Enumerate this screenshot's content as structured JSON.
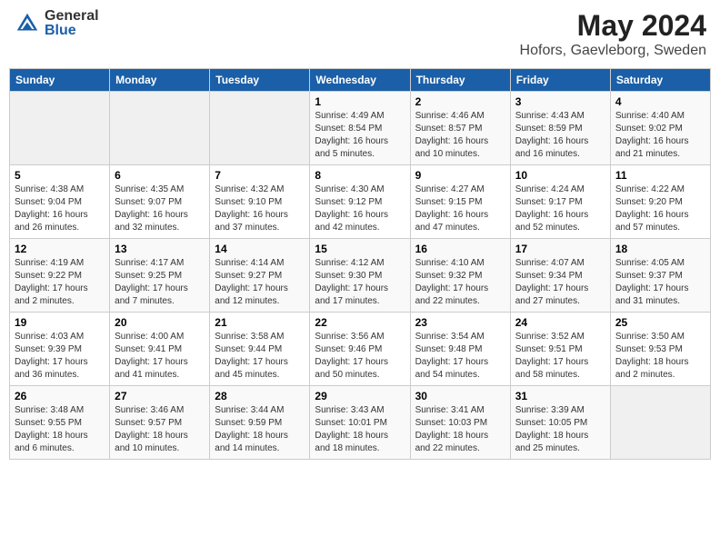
{
  "header": {
    "logo_general": "General",
    "logo_blue": "Blue",
    "month": "May 2024",
    "location": "Hofors, Gaevleborg, Sweden"
  },
  "weekdays": [
    "Sunday",
    "Monday",
    "Tuesday",
    "Wednesday",
    "Thursday",
    "Friday",
    "Saturday"
  ],
  "weeks": [
    [
      {
        "day": "",
        "info": ""
      },
      {
        "day": "",
        "info": ""
      },
      {
        "day": "",
        "info": ""
      },
      {
        "day": "1",
        "info": "Sunrise: 4:49 AM\nSunset: 8:54 PM\nDaylight: 16 hours\nand 5 minutes."
      },
      {
        "day": "2",
        "info": "Sunrise: 4:46 AM\nSunset: 8:57 PM\nDaylight: 16 hours\nand 10 minutes."
      },
      {
        "day": "3",
        "info": "Sunrise: 4:43 AM\nSunset: 8:59 PM\nDaylight: 16 hours\nand 16 minutes."
      },
      {
        "day": "4",
        "info": "Sunrise: 4:40 AM\nSunset: 9:02 PM\nDaylight: 16 hours\nand 21 minutes."
      }
    ],
    [
      {
        "day": "5",
        "info": "Sunrise: 4:38 AM\nSunset: 9:04 PM\nDaylight: 16 hours\nand 26 minutes."
      },
      {
        "day": "6",
        "info": "Sunrise: 4:35 AM\nSunset: 9:07 PM\nDaylight: 16 hours\nand 32 minutes."
      },
      {
        "day": "7",
        "info": "Sunrise: 4:32 AM\nSunset: 9:10 PM\nDaylight: 16 hours\nand 37 minutes."
      },
      {
        "day": "8",
        "info": "Sunrise: 4:30 AM\nSunset: 9:12 PM\nDaylight: 16 hours\nand 42 minutes."
      },
      {
        "day": "9",
        "info": "Sunrise: 4:27 AM\nSunset: 9:15 PM\nDaylight: 16 hours\nand 47 minutes."
      },
      {
        "day": "10",
        "info": "Sunrise: 4:24 AM\nSunset: 9:17 PM\nDaylight: 16 hours\nand 52 minutes."
      },
      {
        "day": "11",
        "info": "Sunrise: 4:22 AM\nSunset: 9:20 PM\nDaylight: 16 hours\nand 57 minutes."
      }
    ],
    [
      {
        "day": "12",
        "info": "Sunrise: 4:19 AM\nSunset: 9:22 PM\nDaylight: 17 hours\nand 2 minutes."
      },
      {
        "day": "13",
        "info": "Sunrise: 4:17 AM\nSunset: 9:25 PM\nDaylight: 17 hours\nand 7 minutes."
      },
      {
        "day": "14",
        "info": "Sunrise: 4:14 AM\nSunset: 9:27 PM\nDaylight: 17 hours\nand 12 minutes."
      },
      {
        "day": "15",
        "info": "Sunrise: 4:12 AM\nSunset: 9:30 PM\nDaylight: 17 hours\nand 17 minutes."
      },
      {
        "day": "16",
        "info": "Sunrise: 4:10 AM\nSunset: 9:32 PM\nDaylight: 17 hours\nand 22 minutes."
      },
      {
        "day": "17",
        "info": "Sunrise: 4:07 AM\nSunset: 9:34 PM\nDaylight: 17 hours\nand 27 minutes."
      },
      {
        "day": "18",
        "info": "Sunrise: 4:05 AM\nSunset: 9:37 PM\nDaylight: 17 hours\nand 31 minutes."
      }
    ],
    [
      {
        "day": "19",
        "info": "Sunrise: 4:03 AM\nSunset: 9:39 PM\nDaylight: 17 hours\nand 36 minutes."
      },
      {
        "day": "20",
        "info": "Sunrise: 4:00 AM\nSunset: 9:41 PM\nDaylight: 17 hours\nand 41 minutes."
      },
      {
        "day": "21",
        "info": "Sunrise: 3:58 AM\nSunset: 9:44 PM\nDaylight: 17 hours\nand 45 minutes."
      },
      {
        "day": "22",
        "info": "Sunrise: 3:56 AM\nSunset: 9:46 PM\nDaylight: 17 hours\nand 50 minutes."
      },
      {
        "day": "23",
        "info": "Sunrise: 3:54 AM\nSunset: 9:48 PM\nDaylight: 17 hours\nand 54 minutes."
      },
      {
        "day": "24",
        "info": "Sunrise: 3:52 AM\nSunset: 9:51 PM\nDaylight: 17 hours\nand 58 minutes."
      },
      {
        "day": "25",
        "info": "Sunrise: 3:50 AM\nSunset: 9:53 PM\nDaylight: 18 hours\nand 2 minutes."
      }
    ],
    [
      {
        "day": "26",
        "info": "Sunrise: 3:48 AM\nSunset: 9:55 PM\nDaylight: 18 hours\nand 6 minutes."
      },
      {
        "day": "27",
        "info": "Sunrise: 3:46 AM\nSunset: 9:57 PM\nDaylight: 18 hours\nand 10 minutes."
      },
      {
        "day": "28",
        "info": "Sunrise: 3:44 AM\nSunset: 9:59 PM\nDaylight: 18 hours\nand 14 minutes."
      },
      {
        "day": "29",
        "info": "Sunrise: 3:43 AM\nSunset: 10:01 PM\nDaylight: 18 hours\nand 18 minutes."
      },
      {
        "day": "30",
        "info": "Sunrise: 3:41 AM\nSunset: 10:03 PM\nDaylight: 18 hours\nand 22 minutes."
      },
      {
        "day": "31",
        "info": "Sunrise: 3:39 AM\nSunset: 10:05 PM\nDaylight: 18 hours\nand 25 minutes."
      },
      {
        "day": "",
        "info": ""
      }
    ]
  ]
}
